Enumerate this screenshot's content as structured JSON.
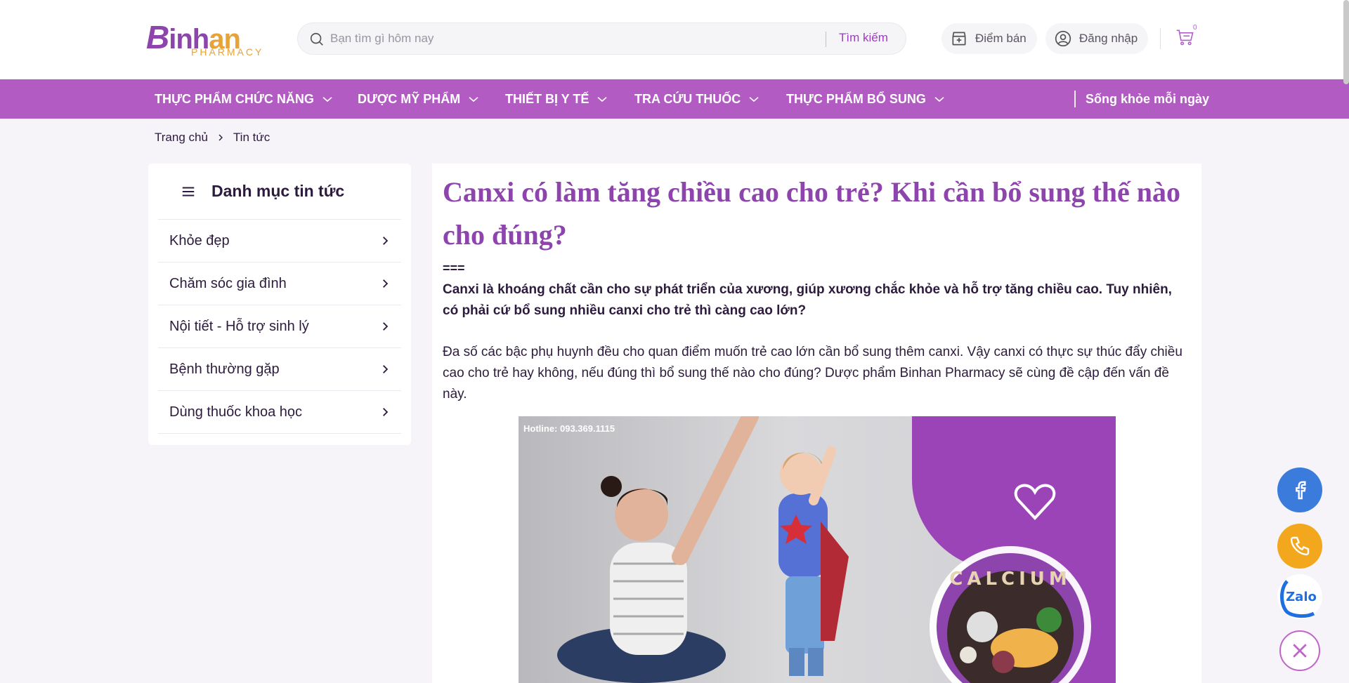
{
  "header": {
    "logo": {
      "brand_b": "B",
      "brand_inh": "inh",
      "brand_an": "an",
      "sub": "PHARMACY"
    },
    "search": {
      "placeholder": "Bạn tìm gì hôm nay",
      "button_label": "Tìm kiếm"
    },
    "store_label": "Điểm bán",
    "login_label": "Đăng nhập",
    "cart_count": "0"
  },
  "nav": {
    "items": [
      {
        "label": "THỰC PHẨM CHỨC NĂNG"
      },
      {
        "label": "DƯỢC MỸ PHẨM"
      },
      {
        "label": "THIẾT BỊ Y TẾ"
      },
      {
        "label": "TRA CỨU THUỐC"
      },
      {
        "label": "THỰC PHẨM BỔ SUNG"
      }
    ],
    "right_label": "Sống khỏe mỗi ngày"
  },
  "breadcrumb": {
    "home": "Trang chủ",
    "current": "Tin tức"
  },
  "sidebar": {
    "title": "Danh mục tin tức",
    "items": [
      {
        "label": "Khỏe đẹp"
      },
      {
        "label": "Chăm sóc gia đình"
      },
      {
        "label": "Nội tiết - Hỗ trợ sinh lý"
      },
      {
        "label": "Bệnh thường gặp"
      },
      {
        "label": "Dùng thuốc khoa học"
      }
    ]
  },
  "article": {
    "title": "Canxi có làm tăng chiều cao cho trẻ? Khi cần bổ sung thế nào cho đúng?",
    "separator": "===",
    "lead": "Canxi là khoáng chất cần cho sự phát triển của xương, giúp xương chắc khỏe và hỗ trợ tăng chiều cao. Tuy nhiên, có phải cứ bổ sung nhiều canxi cho trẻ thì càng cao lớn?",
    "body": "Đa số các bậc phụ huynh đều cho quan điểm muốn trẻ cao lớn cần bổ sung thêm canxi. Vậy canxi có thực sự thúc đẩy chiều cao cho trẻ hay không, nếu đúng thì bổ sung thế nào cho đúng? Dược phẩm Binhan Pharmacy sẽ cùng đề cập đến vấn đề này.",
    "image": {
      "hotline": "Hotline: 093.369.1115",
      "calcium_text": "CALCIUM"
    }
  },
  "floating": {
    "zalo_label": "Zalo"
  },
  "colors": {
    "brand_purple": "#8e44ad",
    "nav_purple": "#b15bc3",
    "accent_orange": "#e7a33a",
    "facebook": "#3b7bdc",
    "phone": "#f2a71d"
  }
}
